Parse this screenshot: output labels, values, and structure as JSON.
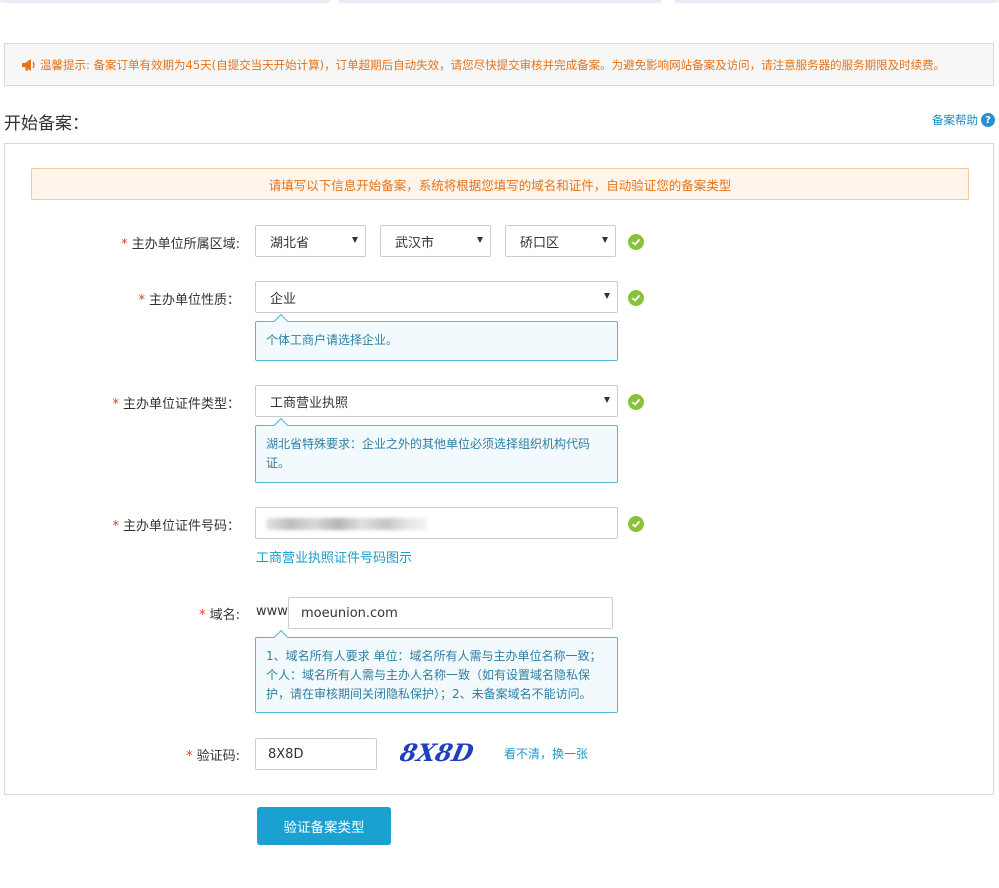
{
  "notice": {
    "text": "温馨提示: 备案订单有效期为45天(自提交当天开始计算)，订单超期后自动失效，请您尽快提交审核并完成备案。为避免影响网站备案及访问，请注意服务器的服务期限及时续费。"
  },
  "page": {
    "title": "开始备案：",
    "help_label": "备案帮助",
    "help_icon": "?"
  },
  "banner": {
    "text": "请填写以下信息开始备案，系统将根据您填写的域名和证件，自动验证您的备案类型"
  },
  "required_mark": "*",
  "form": {
    "region": {
      "label": "主办单位所属区域:",
      "province": "湖北省",
      "city": "武汉市",
      "district": "硚口区"
    },
    "unit_nature": {
      "label": "主办单位性质：",
      "value": "企业",
      "tip": "个体工商户请选择企业。"
    },
    "cert_type": {
      "label": "主办单位证件类型：",
      "value": "工商营业执照",
      "tip": "湖北省特殊要求：企业之外的其他单位必须选择组织机构代码证。"
    },
    "cert_number": {
      "label": "主办单位证件号码：",
      "link": "工商营业执照证件号码图示"
    },
    "domain": {
      "label": "域名:",
      "prefix": "www.",
      "value": "moeunion.com",
      "tip": "1、域名所有人要求 单位：域名所有人需与主办单位名称一致；个人：域名所有人需与主办人名称一致（如有设置域名隐私保护，请在审核期间关闭隐私保护）；2、未备案域名不能访问。"
    },
    "captcha": {
      "label": "验证码:",
      "value": "8X8D",
      "image_text": "8X8D",
      "refresh_link": "看不清，换一张"
    }
  },
  "submit_label": "验证备案类型",
  "colors": {
    "accent": "#1ba0d2",
    "warning": "#e3731c",
    "success": "#8ac33b",
    "required": "#ee3333"
  }
}
